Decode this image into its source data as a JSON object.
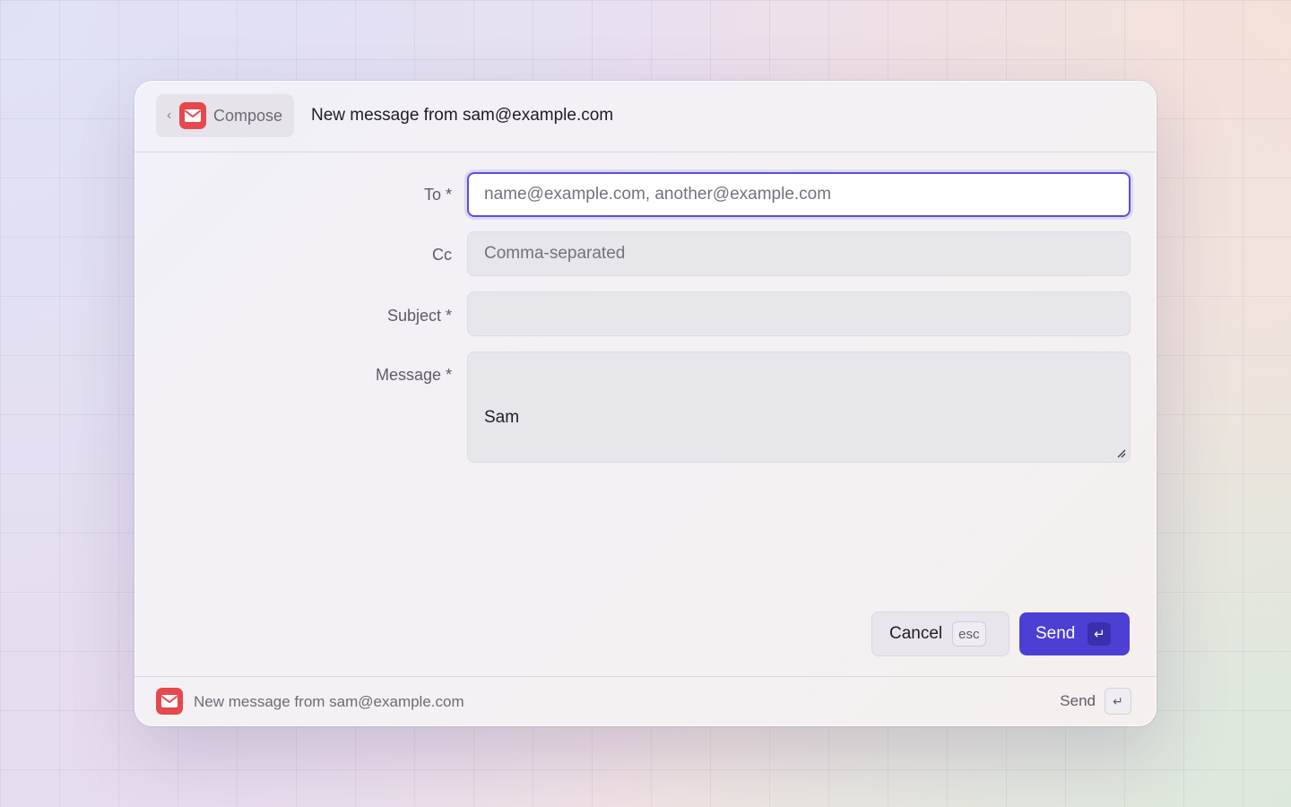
{
  "header": {
    "back_label": "Compose",
    "title": "New message from sam@example.com"
  },
  "form": {
    "to": {
      "label": "To *",
      "placeholder": "name@example.com, another@example.com",
      "value": ""
    },
    "cc": {
      "label": "Cc",
      "placeholder": "Comma-separated",
      "value": ""
    },
    "subject": {
      "label": "Subject *",
      "placeholder": "",
      "value": ""
    },
    "message": {
      "label": "Message *",
      "value": "Sam"
    }
  },
  "actions": {
    "cancel_label": "Cancel",
    "cancel_shortcut": "esc",
    "send_label": "Send",
    "send_shortcut": "↵"
  },
  "footer": {
    "text": "New message from sam@example.com",
    "action_label": "Send",
    "action_shortcut": "↵"
  },
  "colors": {
    "accent": "#4b3fd4",
    "mail_icon": "#e5484d"
  },
  "icons": [
    "chevron-left-icon",
    "mail-icon",
    "resize-handle-icon",
    "enter-key-icon"
  ]
}
